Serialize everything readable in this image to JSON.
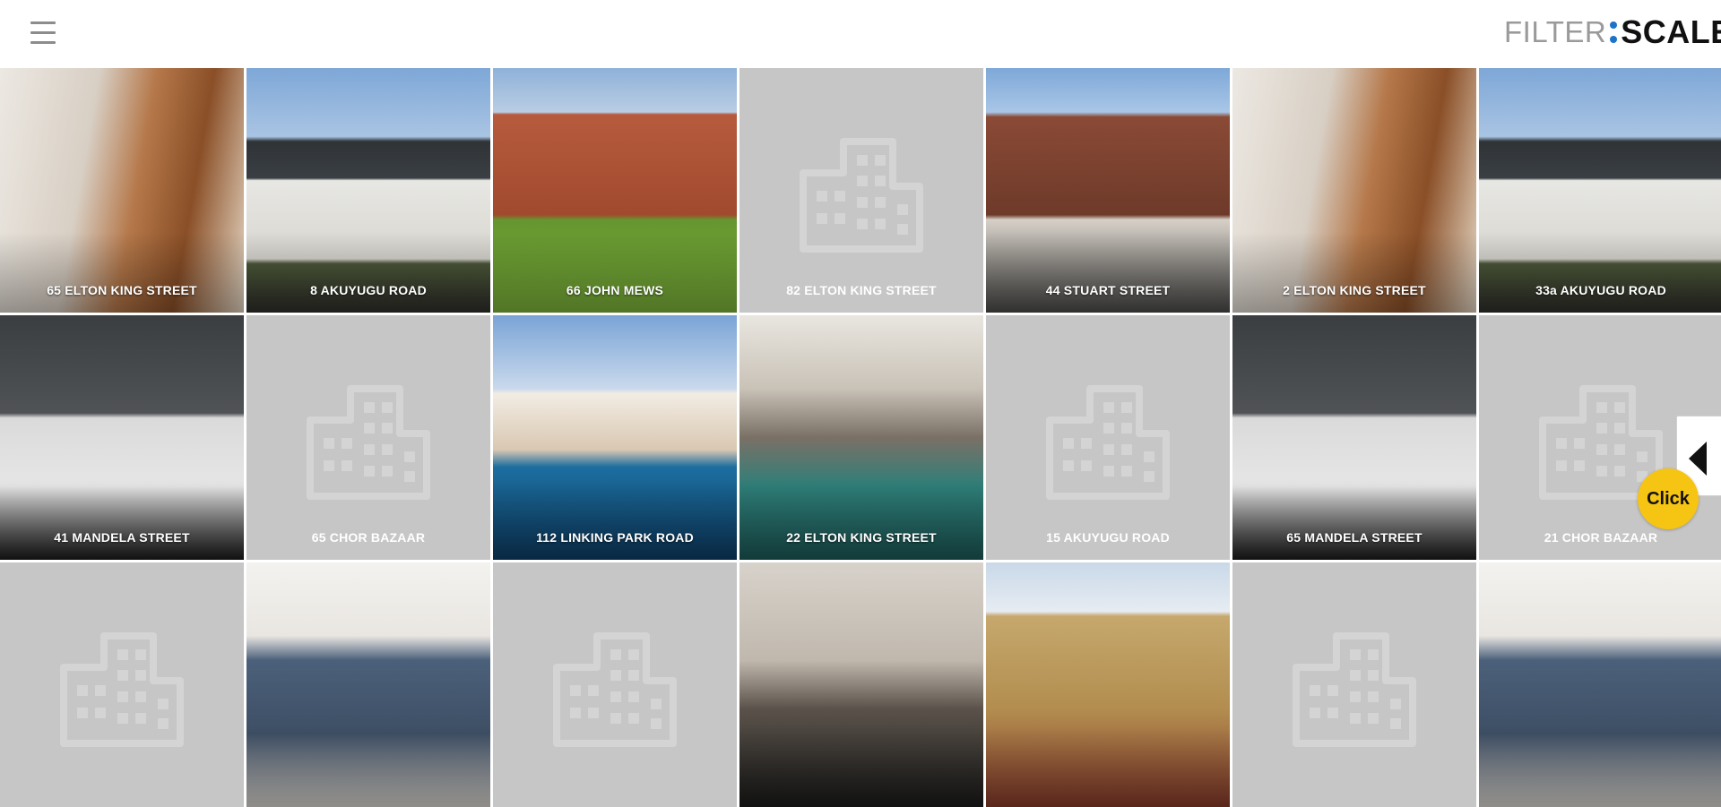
{
  "header": {
    "menu_icon": "hamburger-menu-icon",
    "logo": {
      "filter": "FILTER",
      "scale": "SCALE"
    }
  },
  "tiles": [
    {
      "label": "65 ELTON KING STREET",
      "kind": "photo",
      "scene": "kitchen"
    },
    {
      "label": "8 AKUYUGU ROAD",
      "kind": "photo",
      "scene": "bungalow"
    },
    {
      "label": "66 JOHN MEWS",
      "kind": "photo",
      "scene": "redbrick"
    },
    {
      "label": "82 ELTON KING STREET",
      "kind": "placeholder",
      "scene": "building-icon"
    },
    {
      "label": "44 STUART STREET",
      "kind": "photo",
      "scene": "victorian"
    },
    {
      "label": "2 ELTON KING STREET",
      "kind": "photo",
      "scene": "kitchen"
    },
    {
      "label": "33a AKUYUGU ROAD",
      "kind": "photo",
      "scene": "bungalow"
    },
    {
      "label": "41 MANDELA STREET",
      "kind": "photo",
      "scene": "modern"
    },
    {
      "label": "65 CHOR BAZAAR",
      "kind": "placeholder",
      "scene": "building-icon"
    },
    {
      "label": "112 LINKING PARK ROAD",
      "kind": "photo",
      "scene": "pool"
    },
    {
      "label": "22 ELTON KING STREET",
      "kind": "photo",
      "scene": "indoorpool"
    },
    {
      "label": "15 AKUYUGU ROAD",
      "kind": "placeholder",
      "scene": "building-icon"
    },
    {
      "label": "65 MANDELA STREET",
      "kind": "photo",
      "scene": "modern"
    },
    {
      "label": "21 CHOR BAZAAR",
      "kind": "placeholder",
      "scene": "building-icon"
    },
    {
      "label": "",
      "kind": "placeholder",
      "scene": "building-icon"
    },
    {
      "label": "",
      "kind": "photo",
      "scene": "livingroom"
    },
    {
      "label": "",
      "kind": "placeholder",
      "scene": "building-icon"
    },
    {
      "label": "",
      "kind": "photo",
      "scene": "bathroom"
    },
    {
      "label": "",
      "kind": "photo",
      "scene": "terrace"
    },
    {
      "label": "",
      "kind": "placeholder",
      "scene": "building-icon"
    },
    {
      "label": "",
      "kind": "photo",
      "scene": "livingroom"
    }
  ],
  "controls": {
    "side_tab_icon": "triangle-left-icon",
    "click_button": "Click"
  },
  "colors": {
    "accent_blue": "#1e73c8",
    "button_yellow": "#f6c413",
    "placeholder_bg": "#c6c6c6"
  }
}
